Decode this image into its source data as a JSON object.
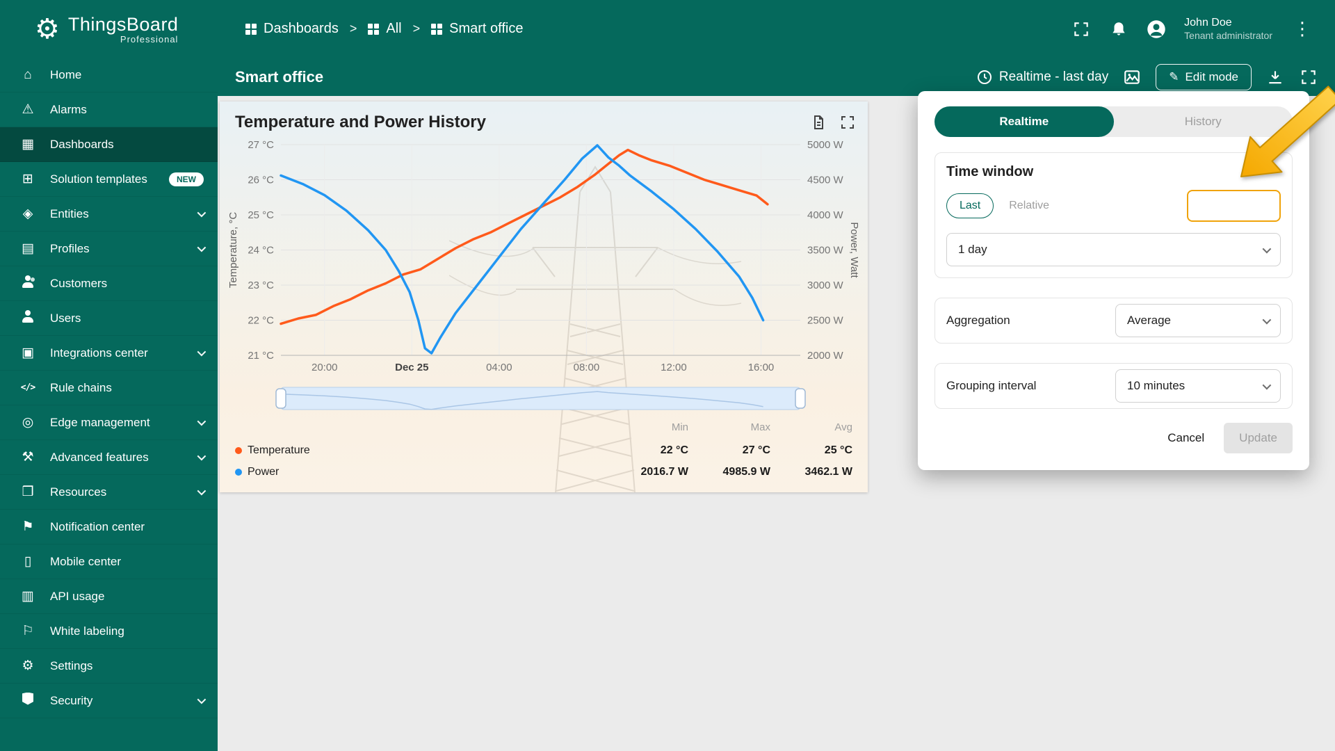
{
  "app": {
    "name": "ThingsBoard",
    "tagline": "Professional"
  },
  "header": {
    "breadcrumb": [
      {
        "label": "Dashboards"
      },
      {
        "label": "All"
      },
      {
        "label": "Smart office"
      }
    ],
    "separator": ">",
    "user": {
      "name": "John Doe",
      "role": "Tenant administrator"
    }
  },
  "toolbar": {
    "title": "Smart office",
    "time_button": "Realtime - last day",
    "edit_button": "Edit mode"
  },
  "sidebar": {
    "items": [
      {
        "label": "Home",
        "icon": "home-icon",
        "glyph": "⌂"
      },
      {
        "label": "Alarms",
        "icon": "alarms-icon",
        "glyph": "⚠"
      },
      {
        "label": "Dashboards",
        "icon": "dashboards-icon",
        "glyph": "▦",
        "active": true
      },
      {
        "label": "Solution templates",
        "icon": "solution-templates-icon",
        "glyph": "⊞",
        "badge": "NEW"
      },
      {
        "label": "Entities",
        "icon": "entities-icon",
        "glyph": "◈",
        "expandable": true
      },
      {
        "label": "Profiles",
        "icon": "profiles-icon",
        "glyph": "▤",
        "expandable": true
      },
      {
        "label": "Customers",
        "icon": "customers-icon",
        "glyph": ""
      },
      {
        "label": "Users",
        "icon": "users-icon",
        "glyph": ""
      },
      {
        "label": "Integrations center",
        "icon": "integrations-center-icon",
        "glyph": "▣",
        "expandable": true
      },
      {
        "label": "Rule chains",
        "icon": "rule-chains-icon",
        "glyph": "</>"
      },
      {
        "label": "Edge management",
        "icon": "edge-management-icon",
        "glyph": "◎",
        "expandable": true
      },
      {
        "label": "Advanced features",
        "icon": "advanced-features-icon",
        "glyph": "⚒",
        "expandable": true
      },
      {
        "label": "Resources",
        "icon": "resources-icon",
        "glyph": "❒",
        "expandable": true
      },
      {
        "label": "Notification center",
        "icon": "notification-center-icon",
        "glyph": "⚑"
      },
      {
        "label": "Mobile center",
        "icon": "mobile-center-icon",
        "glyph": "▯"
      },
      {
        "label": "API usage",
        "icon": "api-usage-icon",
        "glyph": "▥"
      },
      {
        "label": "White labeling",
        "icon": "white-labeling-icon",
        "glyph": "⚐"
      },
      {
        "label": "Settings",
        "icon": "settings-icon",
        "glyph": "⚙"
      },
      {
        "label": "Security",
        "icon": "security-icon",
        "glyph": "",
        "expandable": true
      }
    ]
  },
  "widget": {
    "title": "Temperature and Power History",
    "stats_headers": [
      "Min",
      "Max",
      "Avg"
    ],
    "legend": [
      {
        "name": "Temperature",
        "color": "#ff5a1b",
        "min": "22 °C",
        "max": "27 °C",
        "avg": "25 °C"
      },
      {
        "name": "Power",
        "color": "#2196f3",
        "min": "2016.7 W",
        "max": "4985.9 W",
        "avg": "3462.1 W"
      }
    ]
  },
  "chart_data": {
    "type": "line",
    "title": "Temperature and Power History",
    "x_axis": {
      "range_hours": [
        0,
        23.8
      ],
      "ticks": [
        {
          "h": 2,
          "label": "20:00"
        },
        {
          "h": 6,
          "label": "Dec 25",
          "bold": true
        },
        {
          "h": 10,
          "label": "04:00"
        },
        {
          "h": 14,
          "label": "08:00"
        },
        {
          "h": 18,
          "label": "12:00"
        },
        {
          "h": 22,
          "label": "16:00"
        }
      ]
    },
    "y_left": {
      "label": "Temperature, °C",
      "min": 21,
      "max": 27,
      "tick_step": 1,
      "unit": "°C"
    },
    "y_right": {
      "label": "Power, Watt",
      "min": 2000,
      "max": 5000,
      "tick_step": 500,
      "unit": "W"
    },
    "grid": true,
    "slider": {
      "visible": true,
      "range_percent": [
        0,
        100
      ]
    },
    "series": [
      {
        "name": "Temperature",
        "axis": "left",
        "color": "#ff5a1b",
        "points": [
          [
            0,
            21.9
          ],
          [
            0.8,
            22.05
          ],
          [
            1.6,
            22.15
          ],
          [
            2.4,
            22.4
          ],
          [
            3.2,
            22.6
          ],
          [
            4,
            22.85
          ],
          [
            4.8,
            23.05
          ],
          [
            5.6,
            23.3
          ],
          [
            6.4,
            23.45
          ],
          [
            7.2,
            23.75
          ],
          [
            8,
            24.05
          ],
          [
            8.8,
            24.3
          ],
          [
            9.6,
            24.5
          ],
          [
            10.4,
            24.75
          ],
          [
            11.2,
            25.0
          ],
          [
            12,
            25.25
          ],
          [
            12.8,
            25.5
          ],
          [
            13.6,
            25.8
          ],
          [
            14.4,
            26.15
          ],
          [
            15,
            26.45
          ],
          [
            15.5,
            26.7
          ],
          [
            15.9,
            26.85
          ],
          [
            16.4,
            26.7
          ],
          [
            17,
            26.55
          ],
          [
            17.8,
            26.4
          ],
          [
            18.6,
            26.2
          ],
          [
            19.4,
            26.0
          ],
          [
            20.2,
            25.85
          ],
          [
            21,
            25.7
          ],
          [
            21.8,
            25.55
          ],
          [
            22.3,
            25.3
          ]
        ]
      },
      {
        "name": "Power",
        "axis": "right",
        "color": "#2196f3",
        "points": [
          [
            0,
            4560
          ],
          [
            1,
            4440
          ],
          [
            2,
            4280
          ],
          [
            3,
            4060
          ],
          [
            4,
            3780
          ],
          [
            4.8,
            3500
          ],
          [
            5.4,
            3200
          ],
          [
            5.9,
            2900
          ],
          [
            6.3,
            2500
          ],
          [
            6.6,
            2100
          ],
          [
            6.9,
            2030
          ],
          [
            7.3,
            2250
          ],
          [
            8,
            2600
          ],
          [
            9,
            3000
          ],
          [
            10,
            3400
          ],
          [
            11,
            3800
          ],
          [
            12,
            4150
          ],
          [
            13,
            4500
          ],
          [
            13.8,
            4800
          ],
          [
            14.5,
            4990
          ],
          [
            15,
            4820
          ],
          [
            15.5,
            4700
          ],
          [
            16,
            4560
          ],
          [
            17,
            4330
          ],
          [
            18,
            4080
          ],
          [
            19,
            3800
          ],
          [
            20,
            3480
          ],
          [
            21,
            3120
          ],
          [
            21.6,
            2820
          ],
          [
            22.1,
            2500
          ]
        ]
      }
    ]
  },
  "popup": {
    "tabs": [
      {
        "label": "Realtime",
        "active": true
      },
      {
        "label": "History"
      }
    ],
    "time_window": {
      "title": "Time window",
      "modes": [
        {
          "label": "Last",
          "active": true
        },
        {
          "label": "Relative"
        }
      ],
      "interval": "1 day",
      "highlight_value": ""
    },
    "aggregation": {
      "label": "Aggregation",
      "value": "Average"
    },
    "grouping": {
      "label": "Grouping interval",
      "value": "10 minutes"
    },
    "cancel": "Cancel",
    "update": "Update"
  },
  "annotation": {
    "type": "arrow",
    "color": "#FFC233",
    "points_to": "empty highlighted field"
  },
  "colors": {
    "primary": "#05695C",
    "primary_active": "#044A40",
    "highlight_border": "#F0A30A",
    "temperature_series": "#ff5a1b",
    "power_series": "#2196f3",
    "slider_fill": "#DCEBFB"
  }
}
